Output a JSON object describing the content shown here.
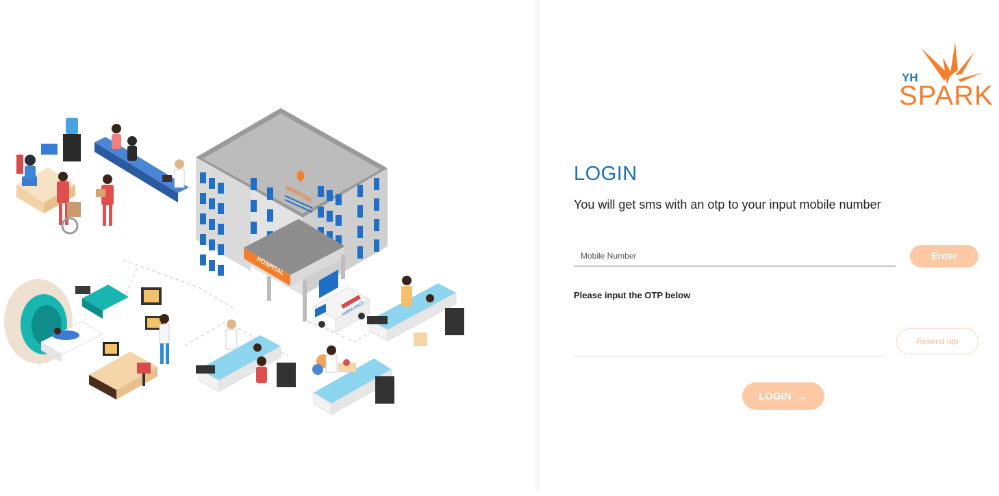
{
  "brand": {
    "prefix": "YH",
    "name": "SPARK",
    "colors": {
      "blue": "#1f74b6",
      "orange": "#f47f2a"
    }
  },
  "illustration": {
    "signs": [
      "HOSPITAL",
      "HOSPITAL",
      "AMBULANCE"
    ]
  },
  "login": {
    "title": "LOGIN",
    "subtitle": "You will get sms with an otp to your input mobile number",
    "mobile_placeholder": "Mobile Number",
    "enter_label": "Enter",
    "otp_label": "Please input the OTP below",
    "resend_label": "Resend otp",
    "submit_label": "LOGIN",
    "submit_icon": "arrow-right-icon"
  },
  "colors": {
    "accent": "#fcc9a4",
    "title": "#1b6fb5"
  }
}
